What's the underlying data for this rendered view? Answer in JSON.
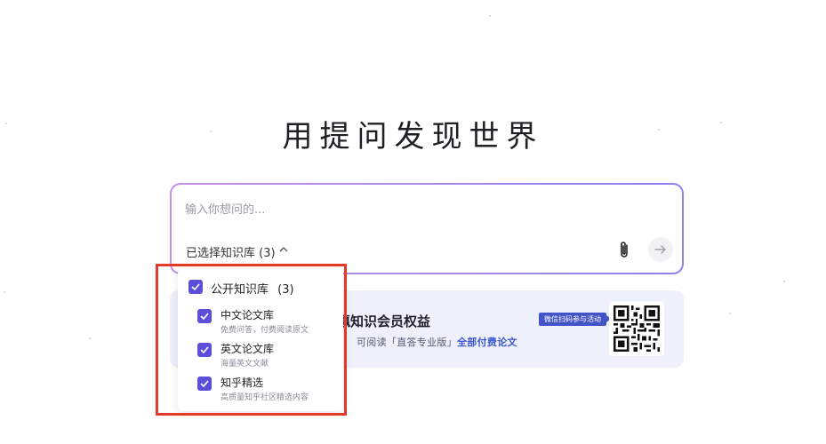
{
  "hero": {
    "title": "用提问发现世界"
  },
  "search": {
    "placeholder": "输入你想问的...",
    "kb_toggle_label": "已选择知识库 (3)",
    "kb_toggle_chevron": "^"
  },
  "promo": {
    "title": "瀛知识会员权益",
    "desc_prefix": "可阅读「直答专业版」",
    "desc_highlight": "全部付费论文",
    "badge": "微信扫码参与活动"
  },
  "kb_dropdown": {
    "group_label": "公开知识库",
    "group_count": "(3)",
    "items": [
      {
        "title": "中文论文库",
        "subtitle": "免费问答，付费阅读原文",
        "checked": true
      },
      {
        "title": "英文论文库",
        "subtitle": "海量英文文献",
        "checked": true
      },
      {
        "title": "知乎精选",
        "subtitle": "高质量知乎社区精选内容",
        "checked": true
      }
    ]
  },
  "colors": {
    "accent": "#5b4fd9",
    "highlight_frame": "#e33a2c",
    "promo_bg": "#eef0fb",
    "promo_link": "#3b57d0"
  },
  "icons": {
    "attach": "paperclip-icon",
    "send": "arrow-right-icon",
    "checkbox": "check-icon",
    "qr": "qr-code-icon"
  }
}
